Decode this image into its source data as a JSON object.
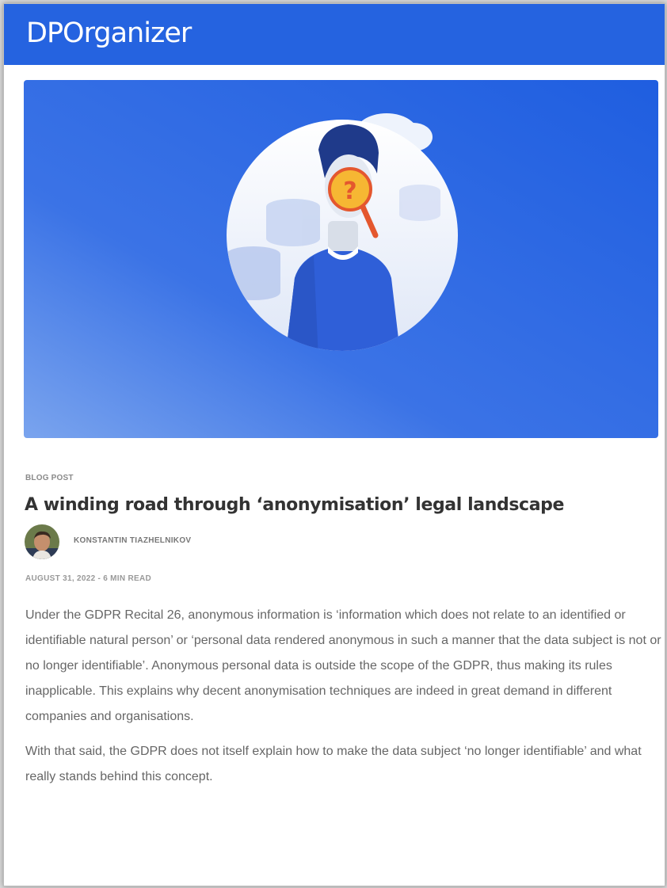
{
  "site": {
    "logo_text": "DPOrganizer",
    "brand_color": "#2563e0"
  },
  "hero": {
    "image_alt": "Illustration of a person with a magnifying glass and question mark over their face",
    "icon": "question-mark-magnifier"
  },
  "article": {
    "kicker": "BLOG POST",
    "title": "A winding road through ‘anonymisation’ legal landscape",
    "author": "KONSTANTIN TIAZHELNIKOV",
    "date_line": "AUGUST 31, 2022 - 6 MIN READ",
    "paragraphs": [
      "Under the GDPR Recital 26, anonymous information is ‘information which does not relate to an identified or identifiable natural person’ or ‘personal data rendered anonymous in such a manner that the data subject is not or no longer identifiable’. Anonymous personal data is outside the scope of the GDPR, thus making its rules inapplicable. This explains why decent anonymisation techniques are indeed in great demand in different companies and organisations.",
      "With that said, the GDPR does not itself explain how to make the data subject ‘no longer identifiable’ and what really stands behind this concept."
    ]
  }
}
